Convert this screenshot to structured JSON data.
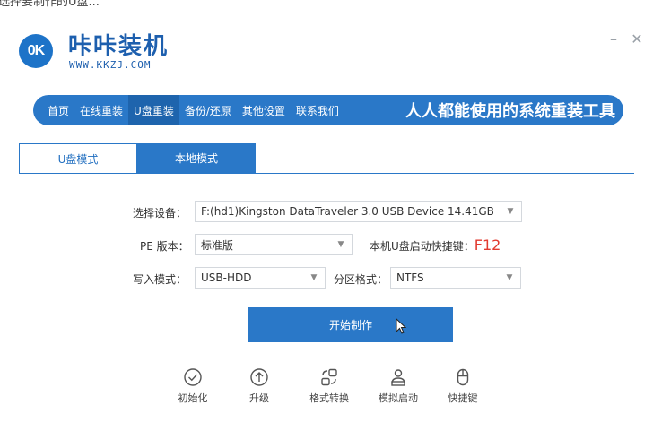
{
  "top_text": "选择要制作的U盘...",
  "brand": {
    "badge": "0K",
    "title": "咔咔装机",
    "url": "WWW.KKZJ.COM"
  },
  "window": {
    "minimize": "–",
    "close": "✕"
  },
  "nav": {
    "items": [
      "首页",
      "在线重装",
      "U盘重装",
      "备份/还原",
      "其他设置",
      "联系我们"
    ],
    "active_index": 2,
    "slogan": "人人都能使用的系统重装工具"
  },
  "tabs": [
    {
      "label": "U盘模式",
      "active": true
    },
    {
      "label": "本地模式",
      "active": false
    }
  ],
  "form": {
    "device_label": "选择设备：",
    "device_value": "F:(hd1)Kingston DataTraveler 3.0 USB Device 14.41GB",
    "pe_label": "PE 版本：",
    "pe_value": "标准版",
    "hotkey_label": "本机U盘启动快捷键：",
    "hotkey_value": "F12",
    "write_label": "写入模式：",
    "write_value": "USB-HDD",
    "partition_label": "分区格式：",
    "partition_value": "NTFS"
  },
  "start_button": "开始制作",
  "tools": [
    {
      "icon": "check-circle-icon",
      "label": "初始化"
    },
    {
      "icon": "upload-circle-icon",
      "label": "升级"
    },
    {
      "icon": "convert-icon",
      "label": "格式转换"
    },
    {
      "icon": "user-device-icon",
      "label": "模拟启动"
    },
    {
      "icon": "mouse-icon",
      "label": "快捷键"
    }
  ],
  "colors": {
    "primary": "#2a78c8",
    "hotkey": "#e23a2f",
    "brand_text": "#1d5fae"
  }
}
